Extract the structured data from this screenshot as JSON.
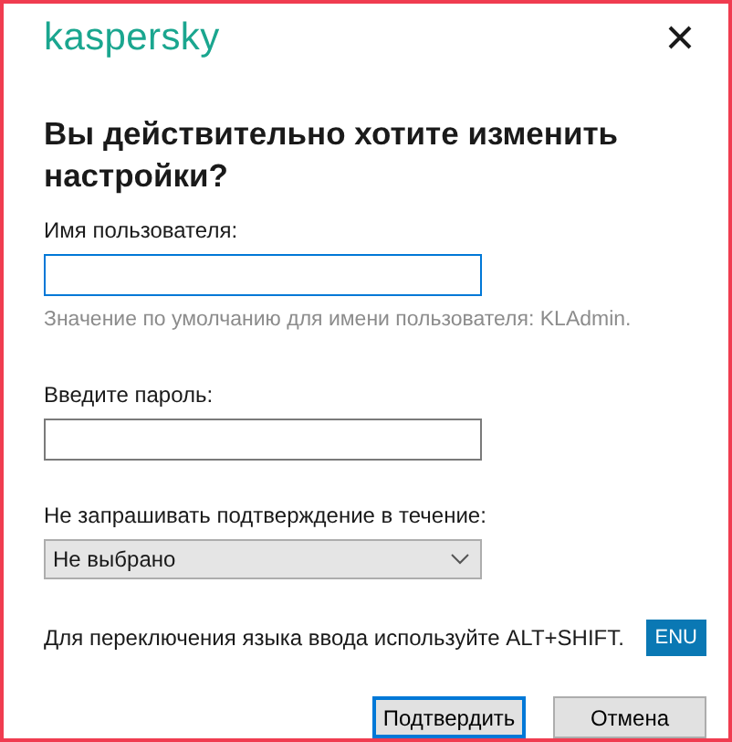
{
  "logo": "kaspersky",
  "title": "Вы действительно хотите изменить настройки?",
  "fields": [
    {
      "label": "Имя пользователя:",
      "focused": true,
      "hint": "Значение по умолчанию для имени пользователя: KLAdmin."
    },
    {
      "label": "Введите пароль:",
      "focused": false
    }
  ],
  "timeout": {
    "label": "Не запрашивать подтверждение в течение:",
    "value": "Не выбрано"
  },
  "language_note": "Для переключения языка ввода используйте ALT+SHIFT.",
  "language_badge": "ENU",
  "buttons": [
    {
      "label": "Подтвердить",
      "default": true
    },
    {
      "label": "Отмена",
      "default": false
    }
  ]
}
